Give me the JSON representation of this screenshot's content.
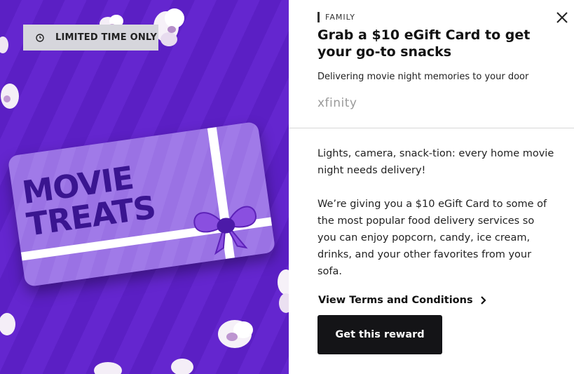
{
  "hero": {
    "badge_text": "LIMITED TIME ONLY",
    "badge_icon": "clock-icon",
    "card_line1": "MOVIE",
    "card_line2": "TREATS"
  },
  "offer": {
    "category": "FAMILY",
    "title": "Grab a $10 eGift Card to get your go-to snacks",
    "subtitle": "Delivering movie night memories to your door",
    "brand": "xfinity",
    "paragraph1": "Lights, camera, snack-tion: every home movie night needs delivery!",
    "paragraph2": "We’re giving you a $10 eGift Card to some of the most popular food delivery services so you can enjoy popcorn, candy, ice cream, drinks, and your other favorites from your sofa.",
    "terms_label": "View Terms and Conditions",
    "cta_label": "Get this reward"
  },
  "colors": {
    "hero_purple": "#5b1fc4",
    "card_lavender": "#a07ae8",
    "card_text": "#3a1590",
    "cta_bg": "#141417"
  }
}
